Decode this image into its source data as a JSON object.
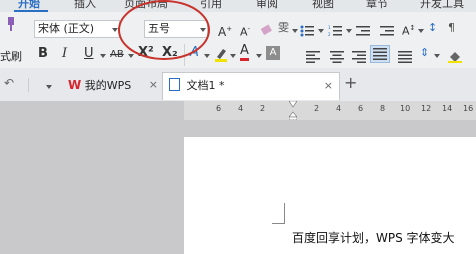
{
  "menu": {
    "tabs": [
      "开始",
      "插入",
      "页面布局",
      "引用",
      "审阅",
      "视图",
      "章节",
      "开发工具"
    ]
  },
  "ribbon": {
    "font_name": "宋体 (正文)",
    "font_size": "五号",
    "format_painter_label": "式刷",
    "superscript_label": "X²",
    "subscript_label": "X₂",
    "bold": "B",
    "italic": "I",
    "underline": "U",
    "strikethrough": "AB",
    "font_color": "A"
  },
  "tabs": {
    "home_label": "我的WPS",
    "doc_label": "文档1 *",
    "new_tab": "+"
  },
  "ruler": {
    "numbers": [
      "6",
      "4",
      "2",
      "2",
      "4",
      "6",
      "8",
      "10",
      "12",
      "14",
      "16"
    ]
  },
  "document": {
    "text": "百度回享计划，WPS 字体变大"
  },
  "colors": {
    "accent": "#2a6fc4",
    "annotation_circle": "#c8322a",
    "wps_red": "#d8262c"
  }
}
